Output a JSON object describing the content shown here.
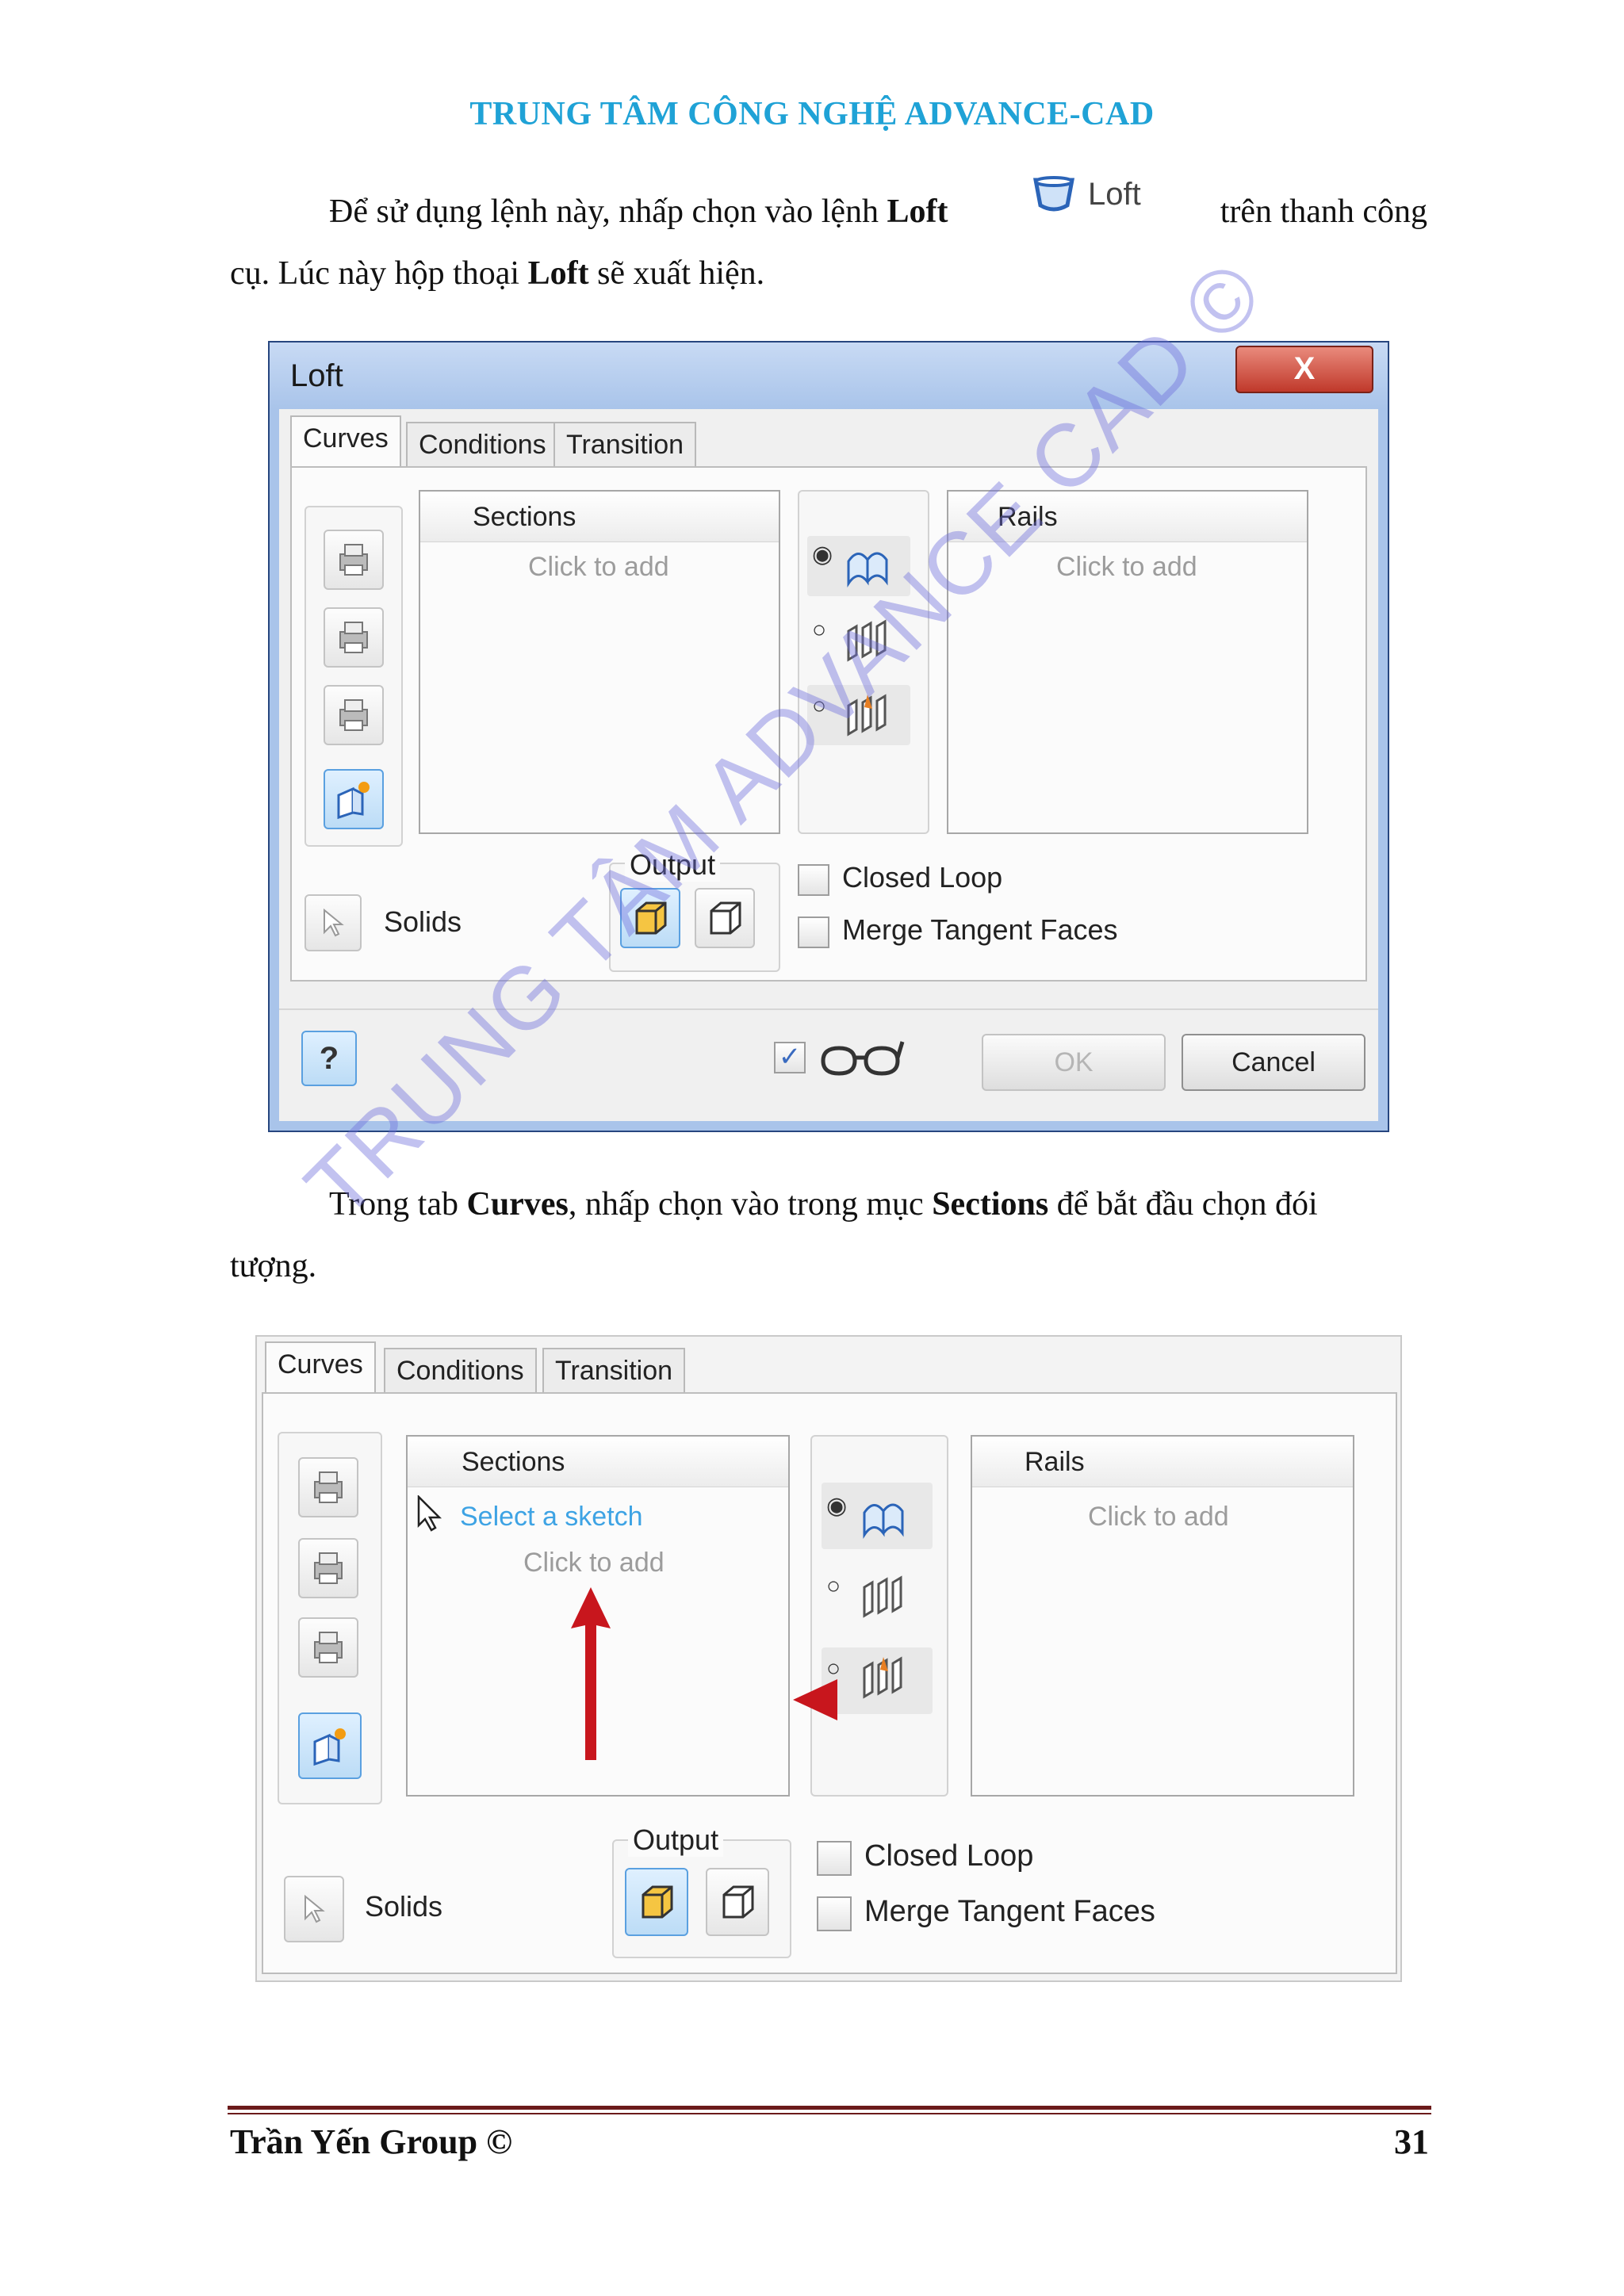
{
  "header": {
    "title": "TRUNG TÂM CÔNG NGHỆ ADVANCE-CAD"
  },
  "intro": {
    "text_a": "Để sử dụng lệnh này, nhấp chọn vào lệnh ",
    "bold_loft": "Loft",
    "text_b": "trên thanh công",
    "text_c": "cụ. Lúc này hộp thoại ",
    "bold_loft2": "Loft",
    "text_d": " sẽ xuất hiện.",
    "toolbar_button_label": "Loft"
  },
  "dialog": {
    "title": "Loft",
    "close_glyph": "X",
    "tabs": [
      "Curves",
      "Conditions",
      "Transition"
    ],
    "sections_header": "Sections",
    "sections_placeholder": "Click to add",
    "rails_header": "Rails",
    "rails_placeholder": "Click to add",
    "output_label": "Output",
    "solids_label": "Solids",
    "closed_loop": "Closed Loop",
    "merge_tangent": "Merge Tangent Faces",
    "ok": "OK",
    "cancel": "Cancel",
    "help_glyph": "?",
    "preview_checked_glyph": "✓"
  },
  "para2": {
    "text_a": "Trong tab ",
    "bold_curves": "Curves",
    "text_b": ", nhấp chọn vào trong mục ",
    "bold_sections": "Sections",
    "text_c": " để bắt đầu chọn đói",
    "text_d": "tượng."
  },
  "shot2": {
    "tabs": [
      "Curves",
      "Conditions",
      "Transition"
    ],
    "sections_header": "Sections",
    "select_hint": "Select a sketch",
    "sections_placeholder": "Click to add",
    "rails_header": "Rails",
    "rails_placeholder": "Click to add",
    "output_label": "Output",
    "solids_label": "Solids",
    "closed_loop": "Closed Loop",
    "merge_tangent": "Merge Tangent Faces"
  },
  "watermark": "TRUNG TÂM ADVANCE CAD ©",
  "footer": {
    "left": "Trần Yến Group ©",
    "page": "31"
  },
  "colors": {
    "header": "#1fa2d6",
    "watermark": "#6e6edc",
    "footer_rule": "#6b1b1b",
    "arrow": "#c8161d"
  }
}
